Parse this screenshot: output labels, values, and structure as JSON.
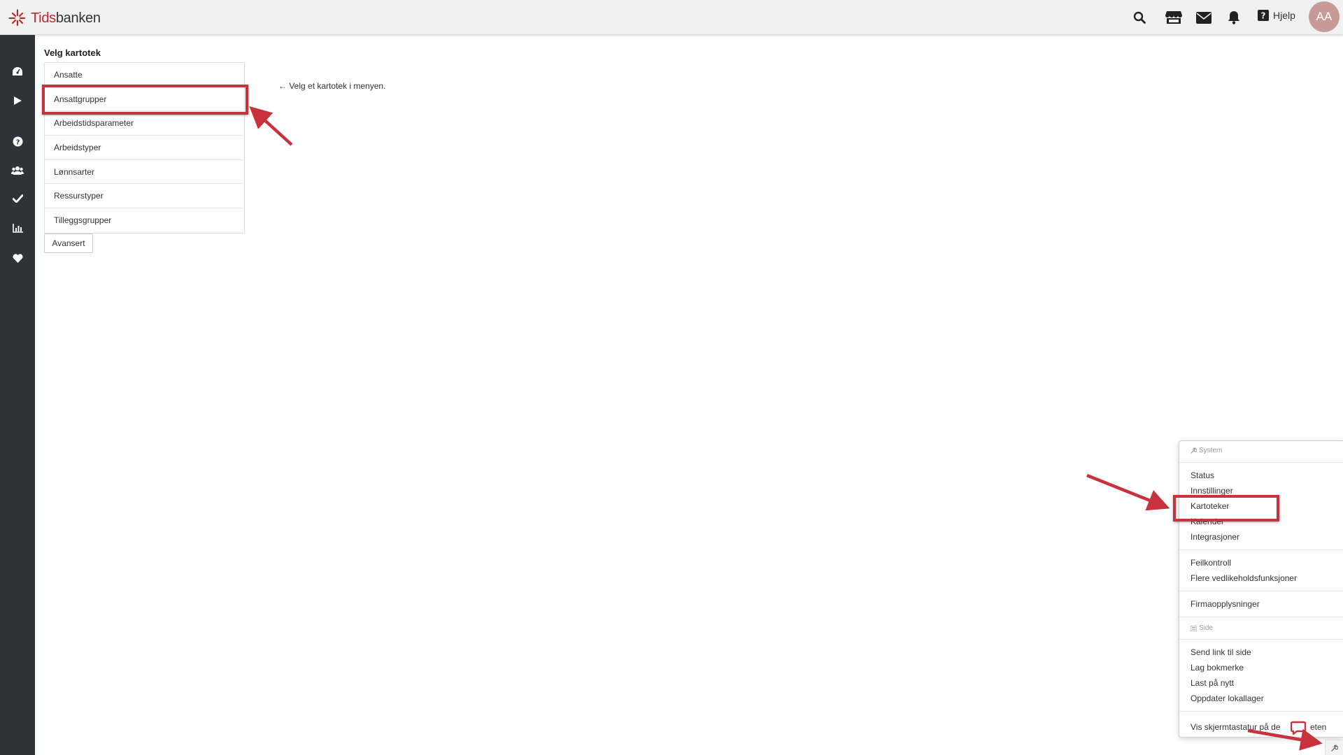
{
  "header": {
    "logo_part1": "Tids",
    "logo_part2": "banken",
    "help_label": "Hjelp",
    "avatar_initials": "AA",
    "accent_color": "#c0272d"
  },
  "main": {
    "section_title": "Velg kartotek",
    "items": [
      {
        "label": "Ansatte"
      },
      {
        "label": "Ansattgrupper"
      },
      {
        "label": "Arbeidstidsparameter"
      },
      {
        "label": "Arbeidstyper"
      },
      {
        "label": "Lønnsarter"
      },
      {
        "label": "Ressurstyper"
      },
      {
        "label": "Tilleggsgrupper"
      }
    ],
    "advanced_button": "Avansert",
    "hint": "← Velg et kartotek i menyen."
  },
  "menu": {
    "system_header": "System",
    "group1": [
      "Status",
      "Innstillinger",
      "Kartoteker",
      "Kalender",
      "Integrasjoner"
    ],
    "group2": [
      "Feilkontroll",
      "Flere vedlikeholdsfunksjoner"
    ],
    "group3": [
      "Firmaopplysninger"
    ],
    "side_header": "Side",
    "group4": [
      "Send link til side",
      "Lag bokmerke",
      "Last på nytt",
      "Oppdater lokallager"
    ],
    "group5": [
      "Vis skjermtastatur på de",
      "eten"
    ]
  }
}
